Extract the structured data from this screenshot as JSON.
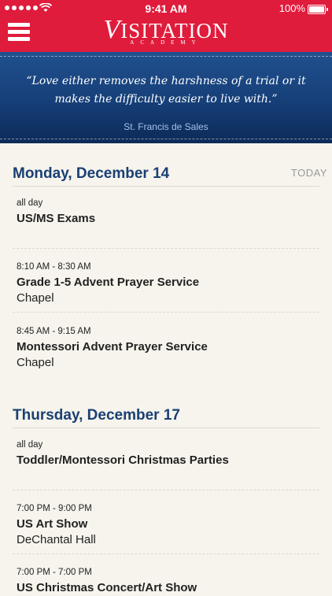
{
  "status_bar": {
    "time": "9:41 AM",
    "battery": "100%"
  },
  "header": {
    "logo_initial": "V",
    "logo_rest": "ISITATION",
    "logo_sub": "ACADEMY"
  },
  "quote": {
    "text": "“Love either removes the harshness of a trial or it makes the difficulty easier to live with.”",
    "author": "St. Francis de Sales"
  },
  "days": [
    {
      "title": "Monday, December 14",
      "badge": "TODAY",
      "events": [
        {
          "time": "all day",
          "title": "US/MS Exams",
          "location": ""
        },
        {
          "time": "8:10 AM - 8:30 AM",
          "title": "Grade 1-5 Advent Prayer Service",
          "location": "Chapel"
        },
        {
          "time": "8:45 AM - 9:15 AM",
          "title": "Montessori Advent Prayer Service",
          "location": "Chapel"
        }
      ]
    },
    {
      "title": "Thursday, December 17",
      "badge": "",
      "events": [
        {
          "time": "all day",
          "title": "Toddler/Montessori Christmas Parties",
          "location": ""
        },
        {
          "time": "7:00 PM - 9:00 PM",
          "title": "US Art Show",
          "location": "DeChantal Hall"
        },
        {
          "time": "7:00 PM - 7:00 PM",
          "title": "US Christmas Concert/Art Show",
          "location": ""
        }
      ]
    }
  ],
  "colors": {
    "header_red": "#e01c3c",
    "quote_blue": "#163f78",
    "day_title": "#1b3f74",
    "background": "#f6f4ec"
  },
  "icons": {
    "menu": "hamburger-menu-icon",
    "wifi": "wifi-icon",
    "battery": "battery-icon",
    "signal": "signal-dots-icon"
  }
}
